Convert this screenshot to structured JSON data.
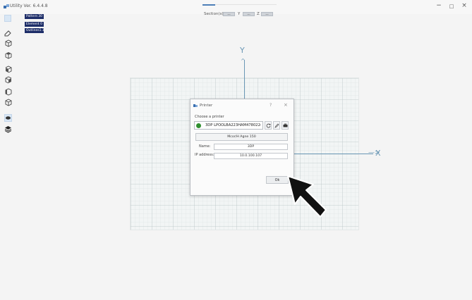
{
  "window": {
    "title": "Utility Ver. 6.4.4.8",
    "minimize_glyph": "−",
    "maximize_glyph": "□",
    "close_glyph": "×"
  },
  "section_toolbar": {
    "label": "Section(s)",
    "box1": "---",
    "axis": "Y",
    "box2": "---",
    "sep": "Z",
    "box3": "---"
  },
  "stats": [
    {
      "label": "Pattern",
      "value": "30"
    },
    {
      "label": "Element",
      "value": "0"
    },
    {
      "label": "Outlines",
      "value": "1.1"
    }
  ],
  "toolbar_icons": [
    "select-icon",
    "eraser-icon",
    "view-iso-icon",
    "view-top-icon",
    "view-front-icon",
    "view-side-icon",
    "view-left-icon",
    "view-right-icon",
    "view-back-icon",
    "eye-icon",
    "layers-icon"
  ],
  "axes": {
    "y": "Y",
    "x": "X",
    "arrow_up": "^",
    "arrow_right": "—>"
  },
  "dialog": {
    "title": "Printer",
    "help": "?",
    "close": "×",
    "choose_label": "Choose a printer",
    "printer_value": "3DP LPOOLBA223HAM478022",
    "chevron": "⌄",
    "model": "Mcor/H Agne 150",
    "name_label": "Name:",
    "name_value": "3DP",
    "address_label": "IP address:",
    "address_value": "10.0.100.107",
    "ok_label": "Ok",
    "status_color": "#2f8f2f"
  }
}
